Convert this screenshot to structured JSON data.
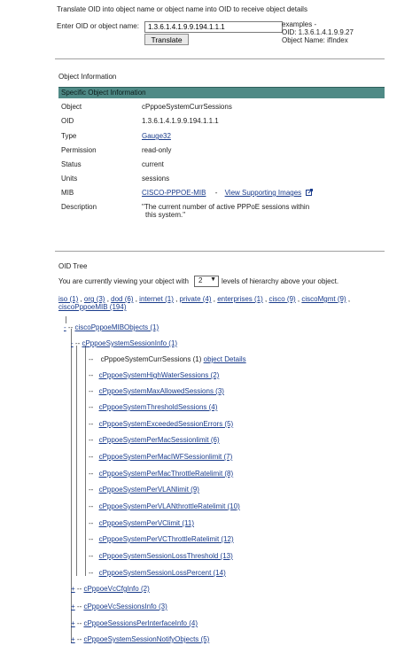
{
  "translate": {
    "heading": "Translate OID into object name or object name into OID to receive object details",
    "label": "Enter OID or object name:",
    "input_value": "1.3.6.1.4.1.9.9.194.1.1.1",
    "button_label": "Translate",
    "examples_line1": "examples -",
    "examples_line2": "OID: 1.3.6.1.4.1.9.9.27",
    "examples_line3": "Object Name: ifIndex"
  },
  "object_info": {
    "section_title": "Object Information",
    "table_title": "Specific Object Information",
    "rows": [
      {
        "key": "Object",
        "value": "cPppoeSystemCurrSessions"
      },
      {
        "key": "OID",
        "value": "1.3.6.1.4.1.9.9.194.1.1.1"
      },
      {
        "key": "Type",
        "value": "Gauge32"
      },
      {
        "key": "Permission",
        "value": "read-only"
      },
      {
        "key": "Status",
        "value": "current"
      },
      {
        "key": "Units",
        "value": "sessions"
      },
      {
        "key": "MIB",
        "value": "CISCO-PPPOE-MIB"
      },
      {
        "key": "Description",
        "value": "\"The current number of active PPPoE sessions within"
      }
    ],
    "mib_separator": "-",
    "supporting_images_link": "View Supporting Images",
    "description_line2": "this system.\""
  },
  "oid_tree": {
    "section_title": "OID Tree",
    "viewing_prefix": "You are currently viewing your object with",
    "levels_value": "2",
    "viewing_suffix": "levels of hierarchy above your object.",
    "breadcrumb": [
      "iso (1)",
      "org (3)",
      "dod (6)",
      "internet (1)",
      "private (4)",
      "enterprises (1)",
      "cisco (9)",
      "ciscoMgmt (9)",
      "ciscoPppoeMIB (194)"
    ],
    "root_node": "ciscoPppoeMIBObjects (1)",
    "session_info_node": "cPppoeSystemSessionInfo (1)",
    "current_leaf": "cPppoeSystemCurrSessions (1)",
    "object_details_link": "object Details",
    "leaves": [
      "cPppoeSystemHighWaterSessions (2)",
      "cPppoeSystemMaxAllowedSessions (3)",
      "cPppoeSystemThresholdSessions (4)",
      "cPppoeSystemExceededSessionErrors (5)",
      "cPppoeSystemPerMacSessionlimit (6)",
      "cPppoeSystemPerMacIWFSessionlimit (7)",
      "cPppoeSystemPerMacThrottleRatelimit (8)",
      "cPppoeSystemPerVLANlimit (9)",
      "cPppoeSystemPerVLANthrottleRatelimit (10)",
      "cPppoeSystemPerVClimit (11)",
      "cPppoeSystemPerVCThrottleRatelimit (12)",
      "cPppoeSystemSessionLossThreshold (13)",
      "cPppoeSystemSessionLossPercent (14)"
    ],
    "siblings": [
      "cPppoeVcCfgInfo (2)",
      "cPppoeVcSessionsInfo (3)",
      "cPppoeSessionsPerInterfaceInfo (4)",
      "cPppoeSystemSessionNotifyObjects (5)"
    ],
    "expand_symbol": "+",
    "collapse_symbol": "-",
    "connector": "--"
  }
}
